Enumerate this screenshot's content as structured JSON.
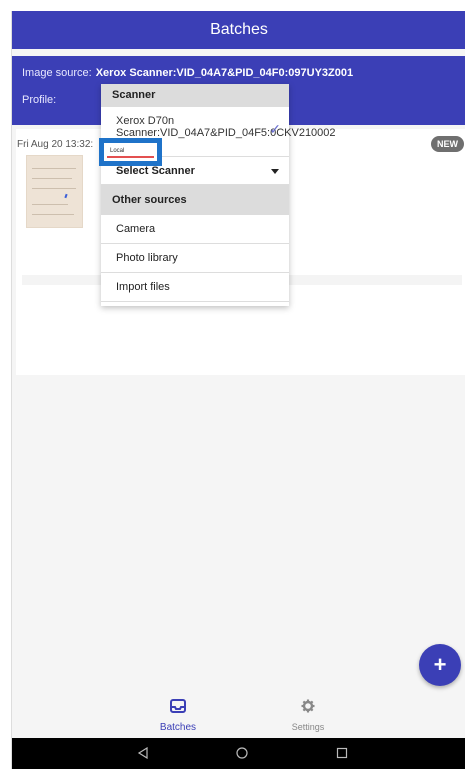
{
  "appbar": {
    "title": "Batches"
  },
  "source": {
    "label": "Image source:",
    "value": "Xerox Scanner:VID_04A7&PID_04F0:097UY3Z001",
    "profile_label": "Profile:"
  },
  "batch": {
    "date": "Fri Aug 20 13:32:",
    "badge": "NEW"
  },
  "dropdown": {
    "header_scanner": "Scanner",
    "selected_scanner": "Xerox D70n Scanner:VID_04A7&PID_04F5:0CKV210002",
    "select_label": "Select Scanner",
    "header_other": "Other sources",
    "items": [
      "Camera",
      "Photo library",
      "Import files"
    ]
  },
  "highlight": {
    "text": "Local"
  },
  "nav": {
    "batches_label": "Batches",
    "settings_label": "Settings"
  },
  "colors": {
    "primary": "#3b3fb6",
    "highlight_border": "#1f73c9",
    "highlight_underline": "#e35050",
    "badge": "#6f6f6f"
  },
  "icons": {
    "fab": "plus-icon",
    "batches": "inbox-tray-icon",
    "settings": "gear-icon",
    "check": "check-icon",
    "caret": "caret-down-icon",
    "sys_back": "back-triangle-icon",
    "sys_home": "home-circle-icon",
    "sys_recents": "recents-square-icon"
  }
}
